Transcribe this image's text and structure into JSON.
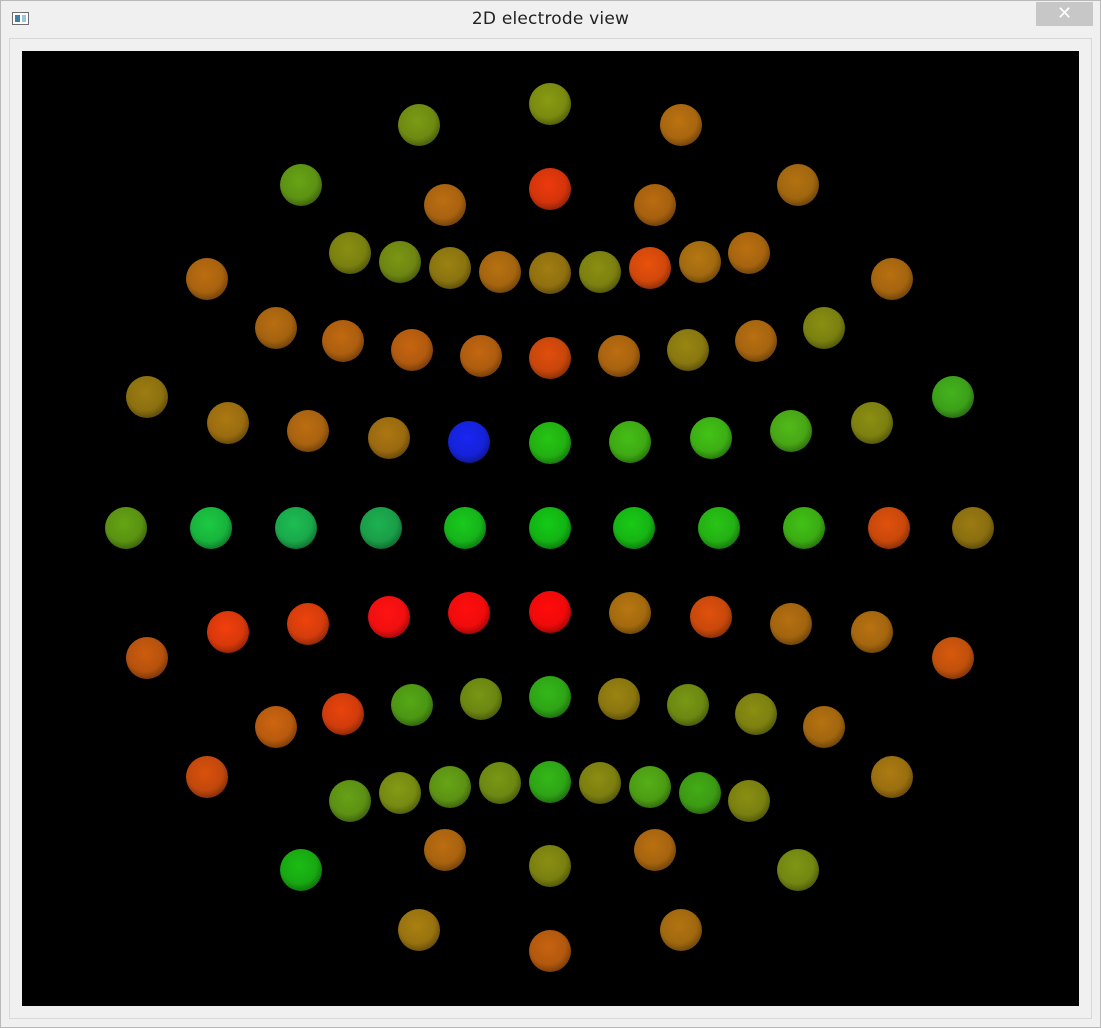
{
  "window": {
    "title": "2D electrode view",
    "close_glyph": "✕"
  },
  "icons": {
    "app": "app-window-icon",
    "close": "close-icon"
  },
  "view": {
    "background": "#000000",
    "electrodes": [
      {
        "color": "#7a8a10"
      },
      {
        "color": "#6e8a12"
      },
      {
        "color": "#a8660f"
      },
      {
        "color": "#5c9214"
      },
      {
        "color": "#a0660f"
      },
      {
        "color": "#a86210"
      },
      {
        "color": "#d4340b"
      },
      {
        "color": "#a6600f"
      },
      {
        "color": "#a8620f"
      },
      {
        "color": "#7a8010"
      },
      {
        "color": "#6e8612"
      },
      {
        "color": "#8a7410"
      },
      {
        "color": "#a4650f"
      },
      {
        "color": "#907010"
      },
      {
        "color": "#7c8010"
      },
      {
        "color": "#d1480b"
      },
      {
        "color": "#a26a10"
      },
      {
        "color": "#a6640f"
      },
      {
        "color": "#a4640f"
      },
      {
        "color": "#a4620f"
      },
      {
        "color": "#ac5e0f"
      },
      {
        "color": "#b15a0f"
      },
      {
        "color": "#ae5c0f"
      },
      {
        "color": "#c8460b"
      },
      {
        "color": "#a8620f"
      },
      {
        "color": "#887810"
      },
      {
        "color": "#a5640f"
      },
      {
        "color": "#7a8010"
      },
      {
        "color": "#8c7010"
      },
      {
        "color": "#3ca01a"
      },
      {
        "color": "#9a6c10"
      },
      {
        "color": "#a8620f"
      },
      {
        "color": "#9a6a10"
      },
      {
        "color": "#1522d8"
      },
      {
        "color": "#22b012"
      },
      {
        "color": "#3eaa14"
      },
      {
        "color": "#3cae14"
      },
      {
        "color": "#48a616"
      },
      {
        "color": "#7c8010"
      },
      {
        "color": "#5a9212"
      },
      {
        "color": "#18b43c"
      },
      {
        "color": "#1aa94a"
      },
      {
        "color": "#1a9e48"
      },
      {
        "color": "#16b41a"
      },
      {
        "color": "#12b414"
      },
      {
        "color": "#16b414"
      },
      {
        "color": "#24b014"
      },
      {
        "color": "#3aac14"
      },
      {
        "color": "#c8480b"
      },
      {
        "color": "#8a6e10"
      },
      {
        "color": "#b6520d"
      },
      {
        "color": "#d8380b"
      },
      {
        "color": "#d43c0c"
      },
      {
        "color": "#f01010"
      },
      {
        "color": "#f00c0c"
      },
      {
        "color": "#f00a0a"
      },
      {
        "color": "#a46a0f"
      },
      {
        "color": "#c8480b"
      },
      {
        "color": "#a2640f"
      },
      {
        "color": "#a4660f"
      },
      {
        "color": "#c0500c"
      },
      {
        "color": "#b85a0e"
      },
      {
        "color": "#d03c0b"
      },
      {
        "color": "#4c9614"
      },
      {
        "color": "#6c8612"
      },
      {
        "color": "#2ea416"
      },
      {
        "color": "#8a7610"
      },
      {
        "color": "#6c8812"
      },
      {
        "color": "#7c8010"
      },
      {
        "color": "#a2660f"
      },
      {
        "color": "#c2480c"
      },
      {
        "color": "#5c9014"
      },
      {
        "color": "#768a12"
      },
      {
        "color": "#5c9214"
      },
      {
        "color": "#6c8812"
      },
      {
        "color": "#2ea416"
      },
      {
        "color": "#7c7e10"
      },
      {
        "color": "#4c9c14"
      },
      {
        "color": "#3c9a14"
      },
      {
        "color": "#7a8010"
      },
      {
        "color": "#9a6e10"
      },
      {
        "color": "#a8620f"
      },
      {
        "color": "#7a8010"
      },
      {
        "color": "#a6640f"
      },
      {
        "color": "#18a812"
      },
      {
        "color": "#728612"
      },
      {
        "color": "#98720f"
      },
      {
        "color": "#b2580e"
      },
      {
        "color": "#a0680f"
      }
    ]
  }
}
